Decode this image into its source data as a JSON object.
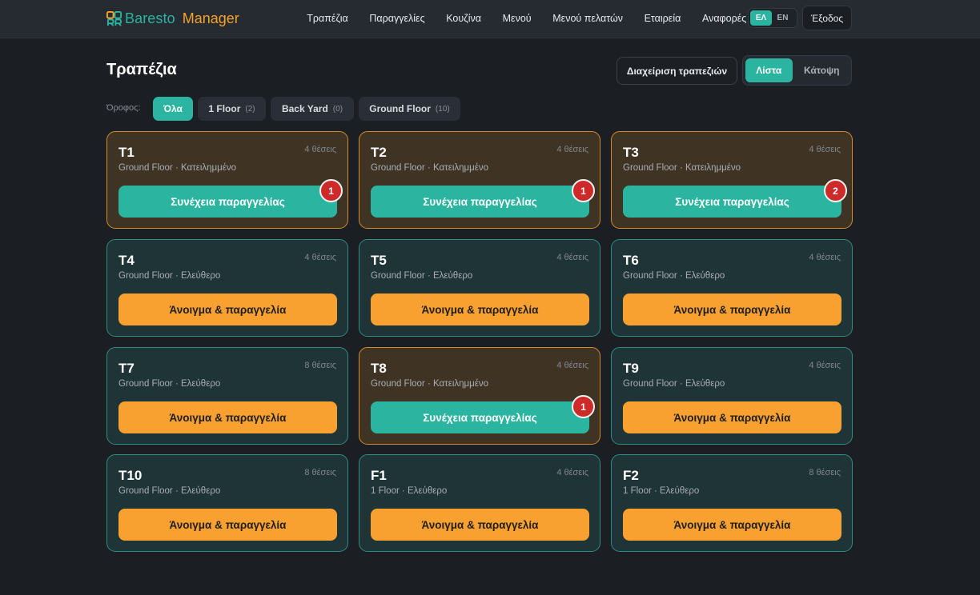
{
  "app": {
    "brand_name": "Baresto",
    "brand_sub": "Manager",
    "colors": {
      "accent": "#2bb5a0",
      "brand_orange": "#f5a32a",
      "free_border": "#2f8c80",
      "busy_border": "#d48b2a",
      "badge": "#cf2a2a"
    }
  },
  "nav": [
    {
      "label": "Τραπέζια"
    },
    {
      "label": "Παραγγελίες"
    },
    {
      "label": "Κουζίνα"
    },
    {
      "label": "Μενού"
    },
    {
      "label": "Μενού πελατών"
    },
    {
      "label": "Εταιρεία"
    },
    {
      "label": "Αναφορές"
    }
  ],
  "lang": {
    "el": "ΕΛ",
    "en": "EN",
    "selected": "ΕΛ"
  },
  "logout_label": "Έξοδος",
  "page": {
    "title": "Τραπέζια",
    "manage_label": "Διαχείριση τραπεζιών",
    "view_list": "Λίστα",
    "view_floor": "Κάτοψη",
    "view_selected": "Λίστα"
  },
  "floors": {
    "label": "Όροφος:",
    "items": [
      {
        "label": "Όλα",
        "count": "",
        "active": true
      },
      {
        "label": "1 Floor",
        "count": "(2)",
        "active": false
      },
      {
        "label": "Back Yard",
        "count": "(0)",
        "active": false
      },
      {
        "label": "Ground Floor",
        "count": "(10)",
        "active": false
      }
    ]
  },
  "tables": [
    {
      "name": "T1",
      "seats": "4 θέσεις",
      "sub": "Ground Floor · Κατειλημμένο",
      "status": "busy",
      "button": "Συνέχεια παραγγελίας",
      "badge": "1"
    },
    {
      "name": "T2",
      "seats": "4 θέσεις",
      "sub": "Ground Floor · Κατειλημμένο",
      "status": "busy",
      "button": "Συνέχεια παραγγελίας",
      "badge": "1"
    },
    {
      "name": "T3",
      "seats": "4 θέσεις",
      "sub": "Ground Floor · Κατειλημμένο",
      "status": "busy",
      "button": "Συνέχεια παραγγελίας",
      "badge": "2"
    },
    {
      "name": "T4",
      "seats": "4 θέσεις",
      "sub": "Ground Floor · Ελεύθερο",
      "status": "free",
      "button": "Άνοιγμα & παραγγελία",
      "badge": ""
    },
    {
      "name": "T5",
      "seats": "4 θέσεις",
      "sub": "Ground Floor · Ελεύθερο",
      "status": "free",
      "button": "Άνοιγμα & παραγγελία",
      "badge": ""
    },
    {
      "name": "T6",
      "seats": "4 θέσεις",
      "sub": "Ground Floor · Ελεύθερο",
      "status": "free",
      "button": "Άνοιγμα & παραγγελία",
      "badge": ""
    },
    {
      "name": "T7",
      "seats": "8 θέσεις",
      "sub": "Ground Floor · Ελεύθερο",
      "status": "free",
      "button": "Άνοιγμα & παραγγελία",
      "badge": ""
    },
    {
      "name": "T8",
      "seats": "4 θέσεις",
      "sub": "Ground Floor · Κατειλημμένο",
      "status": "busy",
      "button": "Συνέχεια παραγγελίας",
      "badge": "1"
    },
    {
      "name": "T9",
      "seats": "4 θέσεις",
      "sub": "Ground Floor · Ελεύθερο",
      "status": "free",
      "button": "Άνοιγμα & παραγγελία",
      "badge": ""
    },
    {
      "name": "T10",
      "seats": "8 θέσεις",
      "sub": "Ground Floor · Ελεύθερο",
      "status": "free",
      "button": "Άνοιγμα & παραγγελία",
      "badge": ""
    },
    {
      "name": "F1",
      "seats": "4 θέσεις",
      "sub": "1 Floor · Ελεύθερο",
      "status": "free",
      "button": "Άνοιγμα & παραγγελία",
      "badge": ""
    },
    {
      "name": "F2",
      "seats": "8 θέσεις",
      "sub": "1 Floor · Ελεύθερο",
      "status": "free",
      "button": "Άνοιγμα & παραγγελία",
      "badge": ""
    }
  ]
}
